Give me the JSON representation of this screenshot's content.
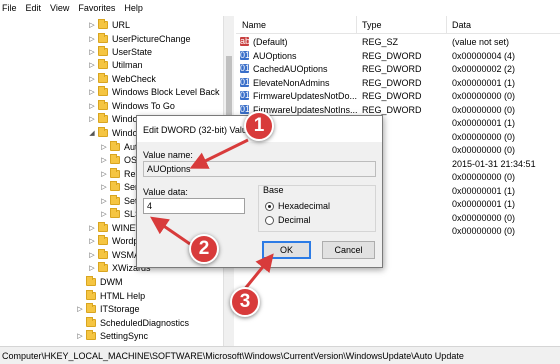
{
  "menu": [
    "File",
    "Edit",
    "View",
    "Favorites",
    "Help"
  ],
  "tree": {
    "items": [
      {
        "label": "URL",
        "exp": "▷"
      },
      {
        "label": "UserPictureChange",
        "exp": "▷"
      },
      {
        "label": "UserState",
        "exp": "▷"
      },
      {
        "label": "Utilman",
        "exp": "▷"
      },
      {
        "label": "WebCheck",
        "exp": "▷"
      },
      {
        "label": "Windows Block Level Back",
        "exp": "▷"
      },
      {
        "label": "Windows To Go",
        "exp": "▷"
      },
      {
        "label": "WindowsStore",
        "exp": "▷"
      },
      {
        "label": "WindowsUpdate",
        "exp": "◢"
      },
      {
        "label": "Auto Update",
        "exp": "▷"
      },
      {
        "label": "OSUpgrade",
        "exp": "▷"
      },
      {
        "label": "RebootRequired",
        "exp": "▷"
      },
      {
        "label": "Services",
        "exp": "▷"
      },
      {
        "label": "Setup",
        "exp": "▷"
      },
      {
        "label": "SLS",
        "exp": "▷"
      },
      {
        "label": "WINEVT",
        "exp": "▷"
      },
      {
        "label": "Wordpad",
        "exp": "▷"
      },
      {
        "label": "WSMAN",
        "exp": "▷"
      },
      {
        "label": "XWizards",
        "exp": "▷"
      },
      {
        "label": "DWM",
        "exp": ""
      },
      {
        "label": "HTML Help",
        "exp": ""
      },
      {
        "label": "ITStorage",
        "exp": "▷"
      },
      {
        "label": "ScheduledDiagnostics",
        "exp": ""
      },
      {
        "label": "SettingSync",
        "exp": "▷"
      }
    ]
  },
  "list": {
    "columns": {
      "name": "Name",
      "type": "Type",
      "data": "Data"
    },
    "rows": [
      {
        "icon": "ab",
        "name": "(Default)",
        "type": "REG_SZ",
        "data": "(value not set)"
      },
      {
        "icon": "dword",
        "name": "AUOptions",
        "type": "REG_DWORD",
        "data": "0x00000004 (4)"
      },
      {
        "icon": "dword",
        "name": "CachedAUOptions",
        "type": "REG_DWORD",
        "data": "0x00000002 (2)"
      },
      {
        "icon": "dword",
        "name": "ElevateNonAdmins",
        "type": "REG_DWORD",
        "data": "0x00000001 (1)"
      },
      {
        "icon": "dword",
        "name": "FirmwareUpdatesNotDo...",
        "type": "REG_DWORD",
        "data": "0x00000000 (0)"
      },
      {
        "icon": "dword",
        "name": "FirmwareUpdatesNotIns...",
        "type": "REG_DWORD",
        "data": "0x00000000 (0)"
      },
      {
        "icon": "dword",
        "name": "",
        "type": "",
        "data": "0x00000001 (1)"
      },
      {
        "icon": "dword",
        "name": "",
        "type": "",
        "data": "0x00000000 (0)"
      },
      {
        "icon": "dword",
        "name": "",
        "type": "",
        "data": "0x00000000 (0)"
      },
      {
        "icon": "ab",
        "name": "",
        "type": "SZ",
        "data": "2015-01-31 21:34:51"
      },
      {
        "icon": "dword",
        "name": "",
        "type": "",
        "data": "0x00000000 (0)"
      },
      {
        "icon": "dword",
        "name": "",
        "type": "",
        "data": "0x00000001 (1)"
      },
      {
        "icon": "dword",
        "name": "",
        "type": "",
        "data": "0x00000001 (1)"
      },
      {
        "icon": "dword",
        "name": "",
        "type": "",
        "data": "0x00000000 (0)"
      },
      {
        "icon": "dword",
        "name": "",
        "type": "",
        "data": "0x00000000 (0)"
      }
    ]
  },
  "status": "Computer\\HKEY_LOCAL_MACHINE\\SOFTWARE\\Microsoft\\Windows\\CurrentVersion\\WindowsUpdate\\Auto Update",
  "dialog": {
    "title": "Edit DWORD (32-bit) Valu",
    "value_name_label": "Value name:",
    "value_name": "AUOptions",
    "value_data_label": "Value data:",
    "value_data": "4",
    "base_label": "Base",
    "hex_label": "Hexadecimal",
    "dec_label": "Decimal",
    "base_selected": "Hexadecimal",
    "ok_label": "OK",
    "cancel_label": "Cancel"
  },
  "callouts": [
    "1",
    "2",
    "3"
  ],
  "colors": {
    "callout": "#d83b3b",
    "arrow": "#d83b3b",
    "selection": "#2c7be5"
  }
}
